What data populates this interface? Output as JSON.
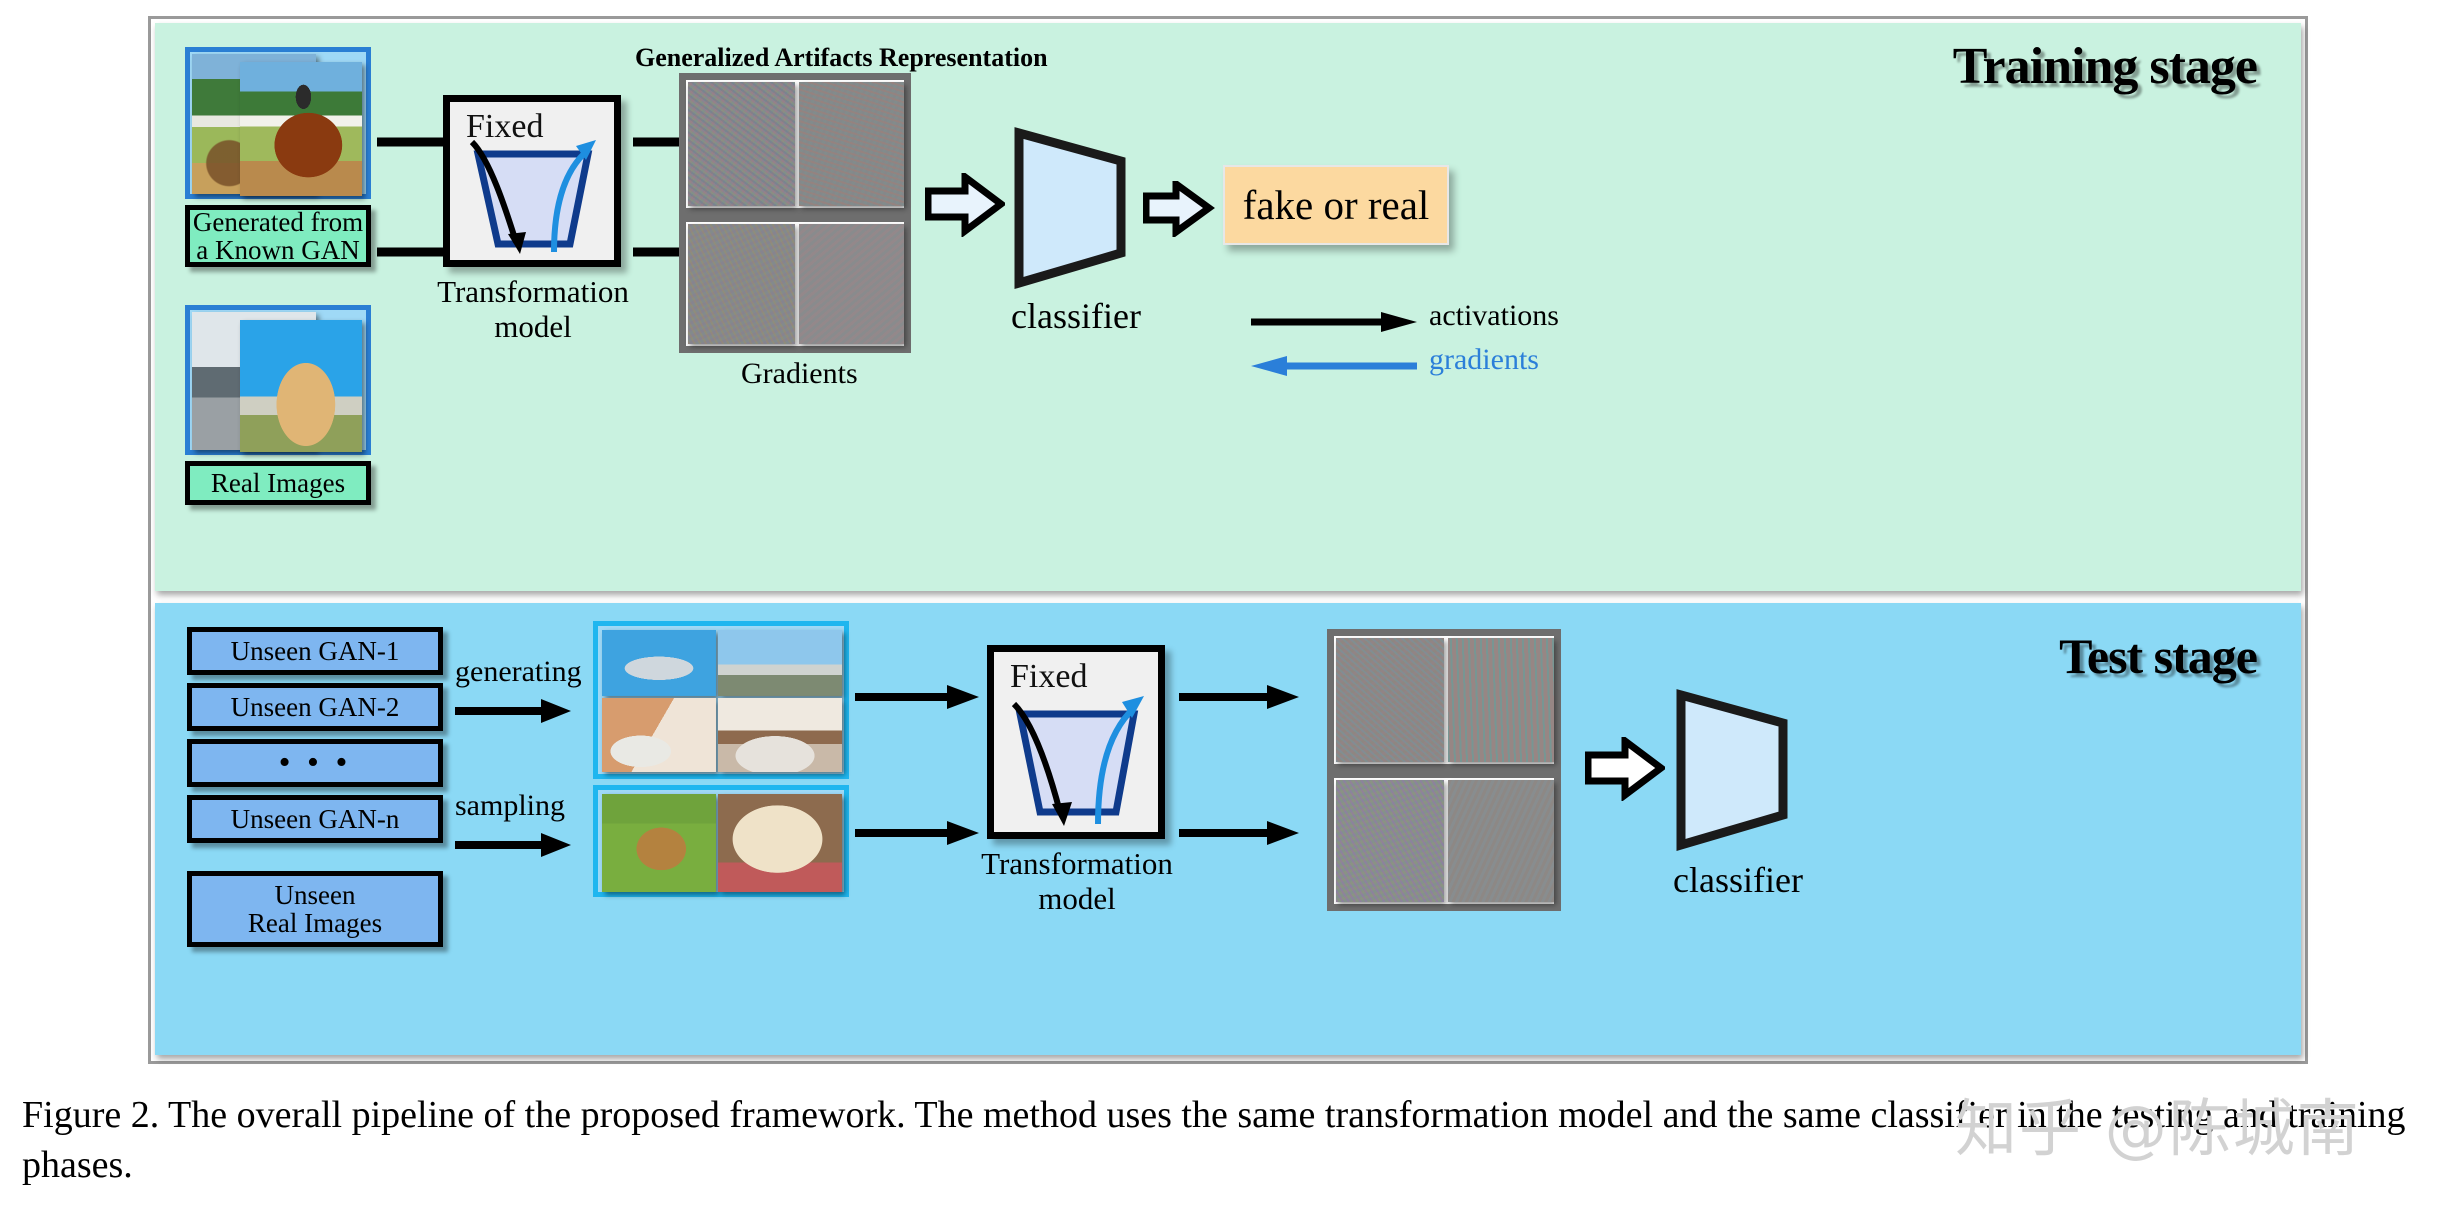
{
  "figure": {
    "caption": "Figure 2. The overall pipeline of the proposed framework. The method uses the same transformation model and the same classifier in the testing and training phases.",
    "watermark": "知乎 @陈城南"
  },
  "training_stage": {
    "title": "Training stage",
    "inputs": [
      {
        "label": "Generated from\na Known GAN",
        "label_line1": "Generated from",
        "label_line2": "a Known GAN"
      },
      {
        "label": "Real Images"
      }
    ],
    "transformation": {
      "fixed_label": "Fixed",
      "caption_line1": "Transformation",
      "caption_line2": "model"
    },
    "gar_title": "Generalized Artifacts Representation",
    "gradients_label": "Gradients",
    "classifier_label": "classifier",
    "output_label": "fake or real",
    "legend": [
      {
        "name": "activations",
        "color": "#000000",
        "direction": "right"
      },
      {
        "name": "gradients",
        "color": "#2b7fd9",
        "direction": "left"
      }
    ]
  },
  "test_stage": {
    "title": "Test stage",
    "gan_items": [
      {
        "label": "Unseen GAN-1"
      },
      {
        "label": "Unseen GAN-2"
      },
      {
        "label": "• • •"
      },
      {
        "label": "Unseen GAN-n"
      }
    ],
    "real_images_box": {
      "line1": "Unseen",
      "line2": "Real Images"
    },
    "arrow_labels": [
      {
        "label": "generating"
      },
      {
        "label": "sampling"
      }
    ],
    "transformation": {
      "fixed_label": "Fixed",
      "caption_line1": "Transformation",
      "caption_line2": "model"
    },
    "classifier_label": "classifier"
  },
  "colors": {
    "train_panel_bg": "#c9f2e0",
    "test_panel_bg": "#8bd9f5",
    "green_label_bg": "#7fecc0",
    "blue_label_bg": "#7eb6f0",
    "output_bg": "#fcd9a0",
    "classifier_fill": "#cfe9fb",
    "gradient_arrow": "#2b7fd9",
    "figure_border": "#9a9a9a"
  }
}
